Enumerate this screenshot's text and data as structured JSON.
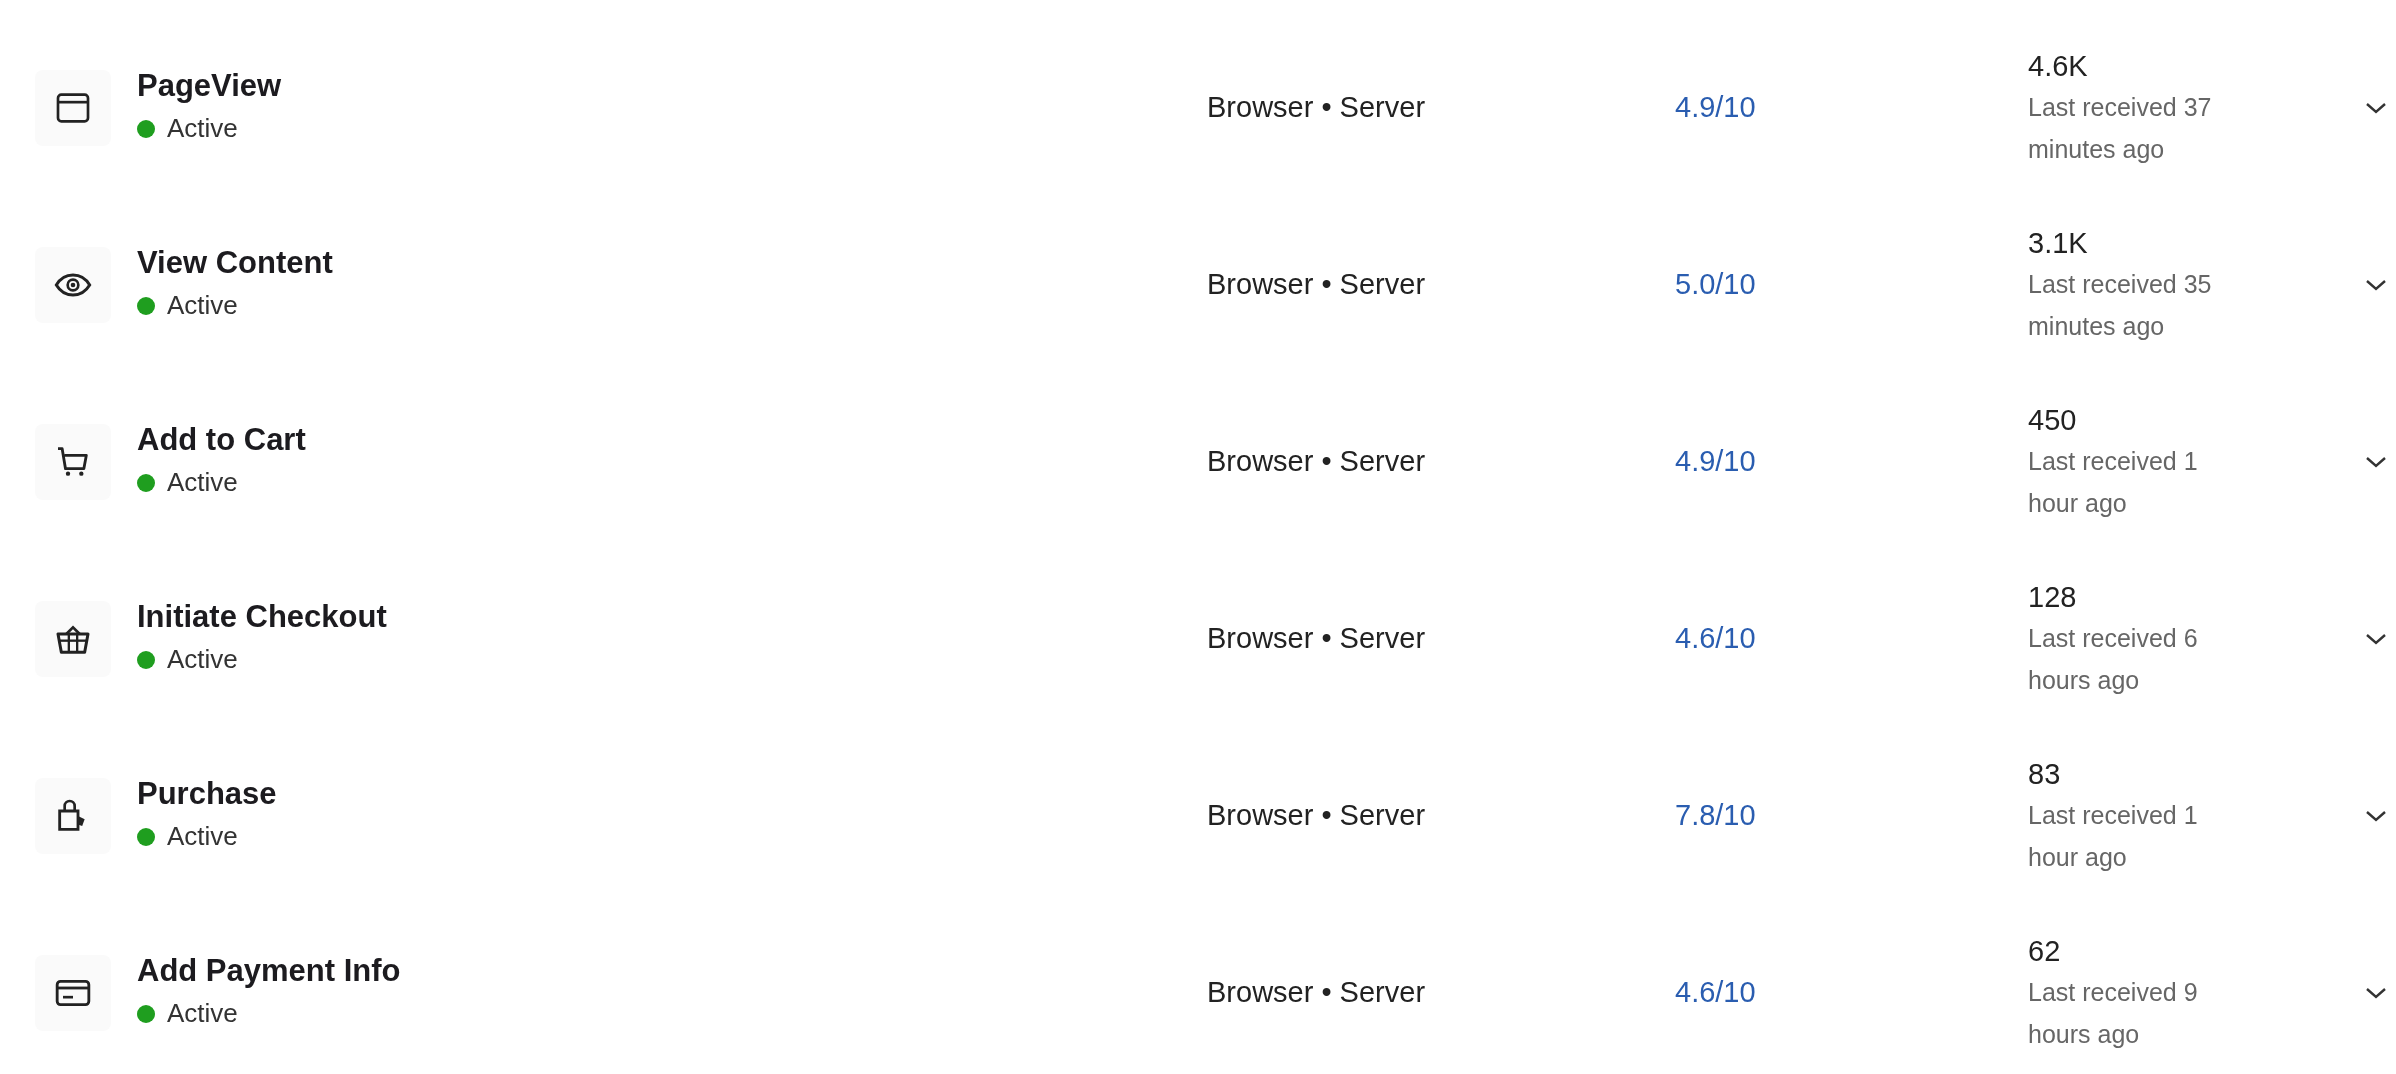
{
  "events": [
    {
      "name": "PageView",
      "active": true,
      "status": "Active",
      "sources": "Browser • Server",
      "score": "4.9/10",
      "count": "4.6K",
      "last_received": "Last received 37 minutes ago",
      "expanded": false
    },
    {
      "name": "View Content",
      "active": true,
      "status": "Active",
      "sources": "Browser • Server",
      "score": "5.0/10",
      "count": "3.1K",
      "last_received": "Last received 35 minutes ago",
      "expanded": false
    },
    {
      "name": "Add to Cart",
      "active": true,
      "status": "Active",
      "sources": "Browser • Server",
      "score": "4.9/10",
      "count": "450",
      "last_received": "Last received 1 hour ago",
      "expanded": false
    },
    {
      "name": "Initiate Checkout",
      "active": true,
      "status": "Active",
      "sources": "Browser • Server",
      "score": "4.6/10",
      "count": "128",
      "last_received": "Last received 6 hours ago",
      "expanded": false
    },
    {
      "name": "Purchase",
      "active": true,
      "status": "Active",
      "sources": "Browser • Server",
      "score": "7.8/10",
      "count": "83",
      "last_received": "Last received 1 hour ago",
      "expanded": false
    },
    {
      "name": "Add Payment Info",
      "active": true,
      "status": "Active",
      "sources": "Browser • Server",
      "score": "4.6/10",
      "count": "62",
      "last_received": "Last received 9 hours ago",
      "expanded": false
    }
  ]
}
